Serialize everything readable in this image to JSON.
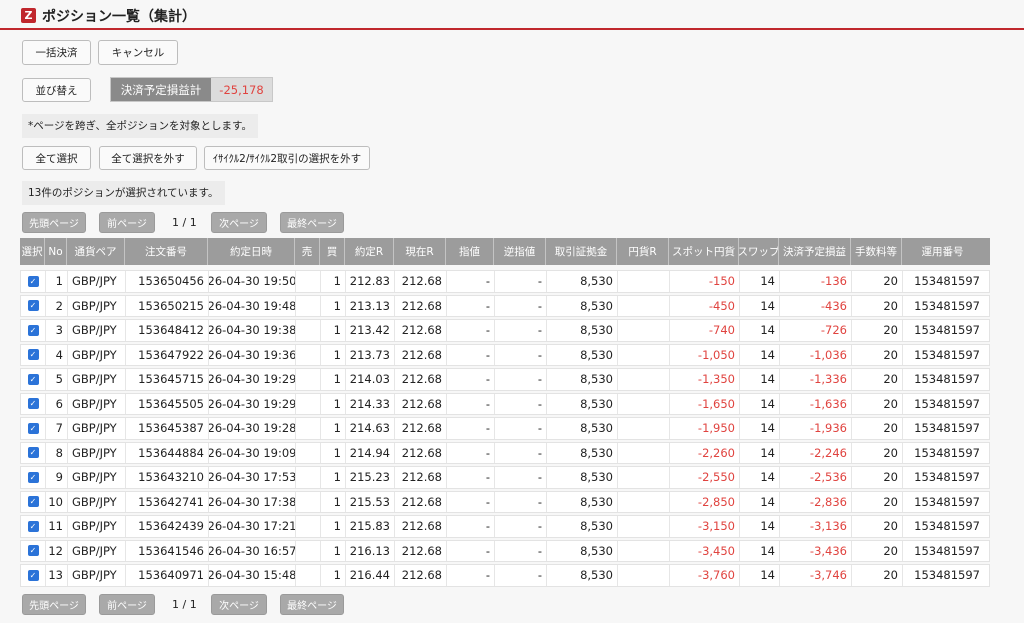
{
  "header": {
    "logo": "Z",
    "title": "ポジション一覧（集計）"
  },
  "buttons": {
    "bulk_settle": "一括決済",
    "cancel": "キャンセル",
    "sort": "並び替え",
    "select_all": "全て選択",
    "deselect_all": "全て選択を外す",
    "deselect_icycle": "ｲｻｲｸﾙ2/ｻｲｸﾙ2取引の選択を外す"
  },
  "summary": {
    "label": "決済予定損益計",
    "value": "-25,178"
  },
  "notes": {
    "cross_page": "*ページを跨ぎ、全ポジションを対象とします。",
    "selected_count": "13件のポジションが選択されています。"
  },
  "pagination": {
    "first": "先頭ページ",
    "prev": "前ページ",
    "page_info": "1 / 1",
    "next": "次ページ",
    "last": "最終ページ"
  },
  "table": {
    "columns": [
      "選択",
      "No",
      "通貨ペア",
      "注文番号",
      "約定日時",
      "売",
      "買",
      "約定R",
      "現在R",
      "指値",
      "逆指値",
      "取引証拠金",
      "円貨R",
      "スポット円貨",
      "スワップ",
      "決済予定損益",
      "手数料等",
      "運用番号"
    ],
    "rows": [
      {
        "no": "1",
        "pair": "GBP/JPY",
        "order": "153650456",
        "date": "26-04-30 19:50",
        "sell": "",
        "buy": "1",
        "exec": "212.83",
        "cur": "212.68",
        "limit": "-",
        "stop": "-",
        "margin": "8,530",
        "jpy": "",
        "spot": "-150",
        "swap": "14",
        "pnl": "-136",
        "fee": "20",
        "op": "153481597"
      },
      {
        "no": "2",
        "pair": "GBP/JPY",
        "order": "153650215",
        "date": "26-04-30 19:48",
        "sell": "",
        "buy": "1",
        "exec": "213.13",
        "cur": "212.68",
        "limit": "-",
        "stop": "-",
        "margin": "8,530",
        "jpy": "",
        "spot": "-450",
        "swap": "14",
        "pnl": "-436",
        "fee": "20",
        "op": "153481597"
      },
      {
        "no": "3",
        "pair": "GBP/JPY",
        "order": "153648412",
        "date": "26-04-30 19:38",
        "sell": "",
        "buy": "1",
        "exec": "213.42",
        "cur": "212.68",
        "limit": "-",
        "stop": "-",
        "margin": "8,530",
        "jpy": "",
        "spot": "-740",
        "swap": "14",
        "pnl": "-726",
        "fee": "20",
        "op": "153481597"
      },
      {
        "no": "4",
        "pair": "GBP/JPY",
        "order": "153647922",
        "date": "26-04-30 19:36",
        "sell": "",
        "buy": "1",
        "exec": "213.73",
        "cur": "212.68",
        "limit": "-",
        "stop": "-",
        "margin": "8,530",
        "jpy": "",
        "spot": "-1,050",
        "swap": "14",
        "pnl": "-1,036",
        "fee": "20",
        "op": "153481597"
      },
      {
        "no": "5",
        "pair": "GBP/JPY",
        "order": "153645715",
        "date": "26-04-30 19:29",
        "sell": "",
        "buy": "1",
        "exec": "214.03",
        "cur": "212.68",
        "limit": "-",
        "stop": "-",
        "margin": "8,530",
        "jpy": "",
        "spot": "-1,350",
        "swap": "14",
        "pnl": "-1,336",
        "fee": "20",
        "op": "153481597"
      },
      {
        "no": "6",
        "pair": "GBP/JPY",
        "order": "153645505",
        "date": "26-04-30 19:29",
        "sell": "",
        "buy": "1",
        "exec": "214.33",
        "cur": "212.68",
        "limit": "-",
        "stop": "-",
        "margin": "8,530",
        "jpy": "",
        "spot": "-1,650",
        "swap": "14",
        "pnl": "-1,636",
        "fee": "20",
        "op": "153481597"
      },
      {
        "no": "7",
        "pair": "GBP/JPY",
        "order": "153645387",
        "date": "26-04-30 19:28",
        "sell": "",
        "buy": "1",
        "exec": "214.63",
        "cur": "212.68",
        "limit": "-",
        "stop": "-",
        "margin": "8,530",
        "jpy": "",
        "spot": "-1,950",
        "swap": "14",
        "pnl": "-1,936",
        "fee": "20",
        "op": "153481597"
      },
      {
        "no": "8",
        "pair": "GBP/JPY",
        "order": "153644884",
        "date": "26-04-30 19:09",
        "sell": "",
        "buy": "1",
        "exec": "214.94",
        "cur": "212.68",
        "limit": "-",
        "stop": "-",
        "margin": "8,530",
        "jpy": "",
        "spot": "-2,260",
        "swap": "14",
        "pnl": "-2,246",
        "fee": "20",
        "op": "153481597"
      },
      {
        "no": "9",
        "pair": "GBP/JPY",
        "order": "153643210",
        "date": "26-04-30 17:53",
        "sell": "",
        "buy": "1",
        "exec": "215.23",
        "cur": "212.68",
        "limit": "-",
        "stop": "-",
        "margin": "8,530",
        "jpy": "",
        "spot": "-2,550",
        "swap": "14",
        "pnl": "-2,536",
        "fee": "20",
        "op": "153481597"
      },
      {
        "no": "10",
        "pair": "GBP/JPY",
        "order": "153642741",
        "date": "26-04-30 17:38",
        "sell": "",
        "buy": "1",
        "exec": "215.53",
        "cur": "212.68",
        "limit": "-",
        "stop": "-",
        "margin": "8,530",
        "jpy": "",
        "spot": "-2,850",
        "swap": "14",
        "pnl": "-2,836",
        "fee": "20",
        "op": "153481597"
      },
      {
        "no": "11",
        "pair": "GBP/JPY",
        "order": "153642439",
        "date": "26-04-30 17:21",
        "sell": "",
        "buy": "1",
        "exec": "215.83",
        "cur": "212.68",
        "limit": "-",
        "stop": "-",
        "margin": "8,530",
        "jpy": "",
        "spot": "-3,150",
        "swap": "14",
        "pnl": "-3,136",
        "fee": "20",
        "op": "153481597"
      },
      {
        "no": "12",
        "pair": "GBP/JPY",
        "order": "153641546",
        "date": "26-04-30 16:57",
        "sell": "",
        "buy": "1",
        "exec": "216.13",
        "cur": "212.68",
        "limit": "-",
        "stop": "-",
        "margin": "8,530",
        "jpy": "",
        "spot": "-3,450",
        "swap": "14",
        "pnl": "-3,436",
        "fee": "20",
        "op": "153481597"
      },
      {
        "no": "13",
        "pair": "GBP/JPY",
        "order": "153640971",
        "date": "26-04-30 15:48",
        "sell": "",
        "buy": "1",
        "exec": "216.44",
        "cur": "212.68",
        "limit": "-",
        "stop": "-",
        "margin": "8,530",
        "jpy": "",
        "spot": "-3,760",
        "swap": "14",
        "pnl": "-3,746",
        "fee": "20",
        "op": "153481597"
      }
    ]
  },
  "colors": {
    "accent": "#c0272d",
    "negative": "#e0433f",
    "checkbox": "#2b73d8",
    "table_header": "#9c9c9c"
  }
}
